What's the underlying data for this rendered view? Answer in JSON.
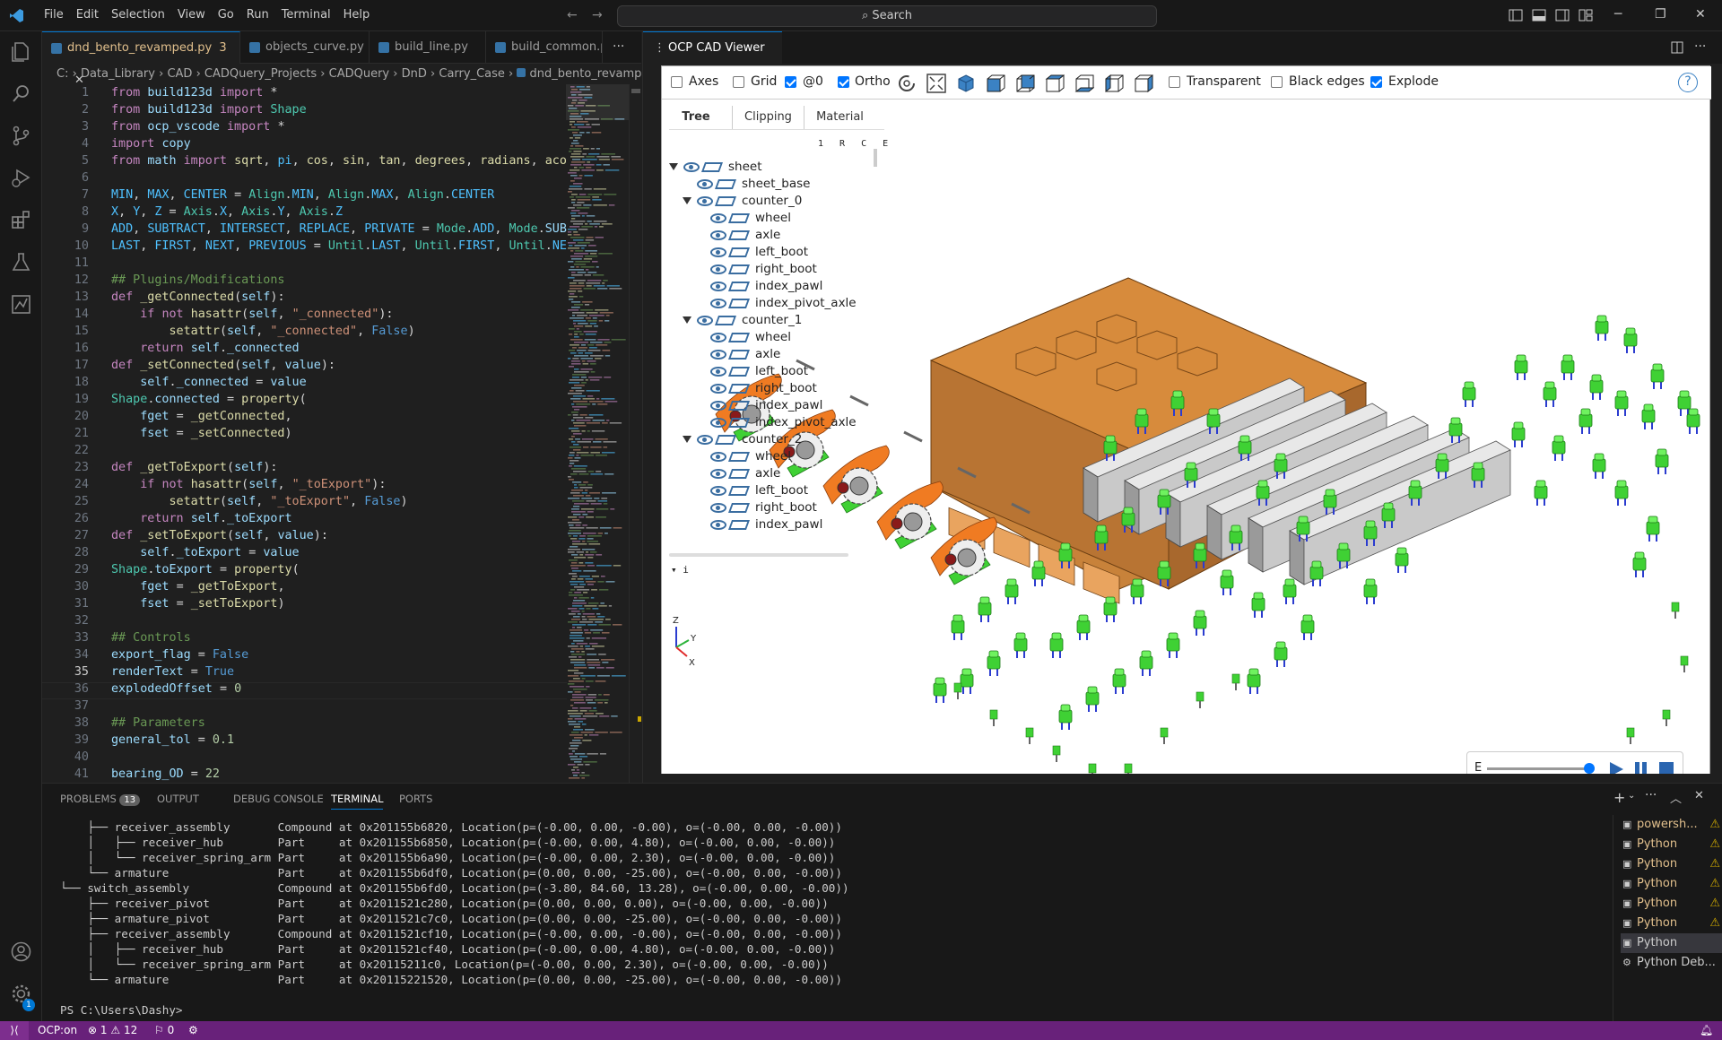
{
  "titlebar": {
    "menu": [
      "File",
      "Edit",
      "Selection",
      "View",
      "Go",
      "Run",
      "Terminal",
      "Help"
    ],
    "search_placeholder": "Search"
  },
  "editor": {
    "tabs": [
      {
        "label": "dnd_bento_revamped.py",
        "badge": "3",
        "active": true
      },
      {
        "label": "objects_curve.py"
      },
      {
        "label": "build_line.py"
      },
      {
        "label": "build_common.p"
      }
    ],
    "breadcrumbs": [
      "C:",
      "Data_Library",
      "CAD",
      "CADQuery_Projects",
      "CADQuery",
      "DnD",
      "Carry_Case",
      "dnd_bento_revamped.py"
    ],
    "current_line": 35,
    "lines": [
      "from build123d import *",
      "from build123d import Shape",
      "from ocp_vscode import *",
      "import copy",
      "from math import sqrt, pi, cos, sin, tan, degrees, radians, acos,",
      "",
      "MIN, MAX, CENTER = Align.MIN, Align.MAX, Align.CENTER",
      "X, Y, Z = Axis.X, Axis.Y, Axis.Z",
      "ADD, SUBTRACT, INTERSECT, REPLACE, PRIVATE = Mode.ADD, Mode.SUBTRA",
      "LAST, FIRST, NEXT, PREVIOUS = Until.LAST, Until.FIRST, Until.NEXT",
      "",
      "## Plugins/Modifications",
      "def _getConnected(self):",
      "    if not hasattr(self, \"_connected\"):",
      "        setattr(self, \"_connected\", False)",
      "    return self._connected",
      "def _setConnected(self, value):",
      "    self._connected = value",
      "Shape.connected = property(",
      "    fget = _getConnected,",
      "    fset = _setConnected)",
      "",
      "def _getToExport(self):",
      "    if not hasattr(self, \"_toExport\"):",
      "        setattr(self, \"_toExport\", False)",
      "    return self._toExport",
      "def _setToExport(self, value):",
      "    self._toExport = value",
      "Shape.toExport = property(",
      "    fget = _getToExport,",
      "    fset = _setToExport)",
      "",
      "## Controls",
      "export_flag = False",
      "renderText = True",
      "explodedOffset = 0",
      "",
      "## Parameters",
      "general_tol = 0.1",
      "",
      "bearing_OD = 22"
    ]
  },
  "viewer": {
    "tab_label": "OCP CAD Viewer",
    "toolbar": {
      "axes": {
        "label": "Axes",
        "checked": false
      },
      "grid": {
        "label": "Grid",
        "checked": false
      },
      "at0": {
        "label": "@0",
        "checked": true
      },
      "ortho": {
        "label": "Ortho",
        "checked": true
      },
      "transparent": {
        "label": "Transparent",
        "checked": false
      },
      "black_edges": {
        "label": "Black edges",
        "checked": false
      },
      "explode": {
        "label": "Explode",
        "checked": true
      },
      "help": "?"
    },
    "tree_tabs": [
      "Tree",
      "Clipping",
      "Material"
    ],
    "tree_columns": "1 R C E",
    "tree": [
      {
        "label": "sheet",
        "level": 0,
        "expanded": true
      },
      {
        "label": "sheet_base",
        "level": 1
      },
      {
        "label": "counter_0",
        "level": 1,
        "expanded": true
      },
      {
        "label": "wheel",
        "level": 2
      },
      {
        "label": "axle",
        "level": 2
      },
      {
        "label": "left_boot",
        "level": 2
      },
      {
        "label": "right_boot",
        "level": 2
      },
      {
        "label": "index_pawl",
        "level": 2
      },
      {
        "label": "index_pivot_axle",
        "level": 2
      },
      {
        "label": "counter_1",
        "level": 1,
        "expanded": true
      },
      {
        "label": "wheel",
        "level": 2
      },
      {
        "label": "axle",
        "level": 2
      },
      {
        "label": "left_boot",
        "level": 2
      },
      {
        "label": "right_boot",
        "level": 2
      },
      {
        "label": "index_pawl",
        "level": 2
      },
      {
        "label": "index_pivot_axle",
        "level": 2
      },
      {
        "label": "counter_2",
        "level": 1,
        "expanded": true
      },
      {
        "label": "wheel",
        "level": 2
      },
      {
        "label": "axle",
        "level": 2
      },
      {
        "label": "left_boot",
        "level": 2
      },
      {
        "label": "right_boot",
        "level": 2
      },
      {
        "label": "index_pawl",
        "level": 2
      }
    ],
    "info_label": "i",
    "axes_labels": {
      "z": "Z",
      "y": "Y",
      "x": "X"
    },
    "anim": {
      "label": "E",
      "progress": 0.95
    }
  },
  "panel": {
    "tabs": [
      {
        "label": "PROBLEMS",
        "badge": "13"
      },
      {
        "label": "OUTPUT"
      },
      {
        "label": "DEBUG CONSOLE"
      },
      {
        "label": "TERMINAL",
        "active": true
      },
      {
        "label": "PORTS"
      }
    ],
    "terminal_lines": [
      "    ├── receiver_assembly       Compound at 0x201155b6820, Location(p=(-0.00, 0.00, -0.00), o=(-0.00, 0.00, -0.00))",
      "    │   ├── receiver_hub        Part     at 0x201155b6850, Location(p=(-0.00, 0.00, 4.80), o=(-0.00, 0.00, -0.00))",
      "    │   └── receiver_spring_arm Part     at 0x201155b6a90, Location(p=(-0.00, 0.00, 2.30), o=(-0.00, 0.00, -0.00))",
      "    └── armature                Part     at 0x201155b6df0, Location(p=(0.00, 0.00, -25.00), o=(-0.00, 0.00, -0.00))",
      "└── switch_assembly             Compound at 0x201155b6fd0, Location(p=(-3.80, 84.60, 13.28), o=(-0.00, 0.00, -0.00))",
      "    ├── receiver_pivot          Part     at 0x2011521c280, Location(p=(0.00, 0.00, 0.00), o=(-0.00, 0.00, -0.00))",
      "    ├── armature_pivot          Part     at 0x2011521c7c0, Location(p=(0.00, 0.00, -25.00), o=(-0.00, 0.00, -0.00))",
      "    ├── receiver_assembly       Compound at 0x2011521cf10, Location(p=(-0.00, 0.00, -0.00), o=(-0.00, 0.00, -0.00))",
      "    │   ├── receiver_hub        Part     at 0x2011521cf40, Location(p=(-0.00, 0.00, 4.80), o=(-0.00, 0.00, -0.00))",
      "    │   └── receiver_spring_arm Part     at 0x20115211c0, Location(p=(-0.00, 0.00, 2.30), o=(-0.00, 0.00, -0.00))",
      "    └── armature                Part     at 0x20115221520, Location(p=(0.00, 0.00, -25.00), o=(-0.00, 0.00, -0.00))",
      "",
      "PS C:\\Users\\Dashy> "
    ],
    "terminals": [
      {
        "label": "powersh...",
        "warn": true
      },
      {
        "label": "Python",
        "warn": true
      },
      {
        "label": "Python",
        "warn": true
      },
      {
        "label": "Python",
        "warn": true
      },
      {
        "label": "Python",
        "warn": true
      },
      {
        "label": "Python",
        "warn": true
      },
      {
        "label": "Python",
        "warn": false,
        "selected": true
      },
      {
        "label": "Python Deb...",
        "warn": false
      }
    ]
  },
  "statusbar": {
    "remote": "OCP:on",
    "errors": "1",
    "warnings": "12",
    "ports": "0"
  },
  "colors": {
    "accent": "#0078d4",
    "statusbar": "#68217a",
    "case": "#d78b3c",
    "keys": "#3fd134",
    "switch_stem": "#2b3ccf",
    "pawl": "#f07b22"
  }
}
